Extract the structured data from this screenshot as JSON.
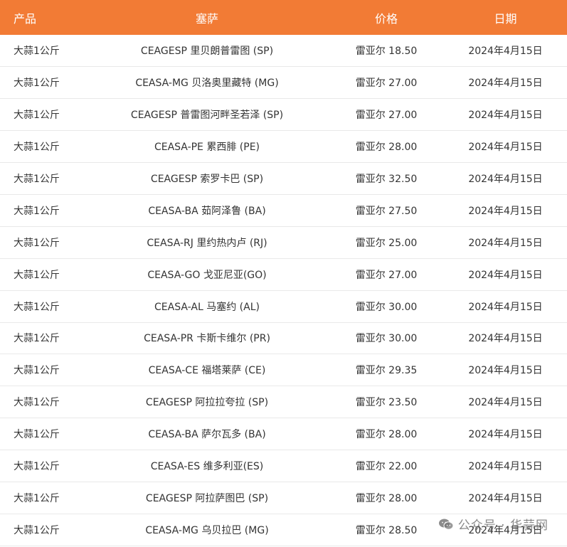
{
  "table": {
    "headers": {
      "product": "产品",
      "market": "塞萨",
      "price": "价格",
      "date": "日期"
    },
    "rows": [
      {
        "product": "大蒜1公斤",
        "market": "CEAGESP 里贝朗普雷图 (SP)",
        "price": "雷亚尔 18.50",
        "date": "2024年4月15日"
      },
      {
        "product": "大蒜1公斤",
        "market": "CEASA-MG 贝洛奥里藏特 (MG)",
        "price": "雷亚尔 27.00",
        "date": "2024年4月15日"
      },
      {
        "product": "大蒜1公斤",
        "market": "CEAGESP 普雷图河畔圣若泽 (SP)",
        "price": "雷亚尔 27.00",
        "date": "2024年4月15日"
      },
      {
        "product": "大蒜1公斤",
        "market": "CEASA-PE 累西腓 (PE)",
        "price": "雷亚尔 28.00",
        "date": "2024年4月15日"
      },
      {
        "product": "大蒜1公斤",
        "market": "CEAGESP 索罗卡巴 (SP)",
        "price": "雷亚尔 32.50",
        "date": "2024年4月15日"
      },
      {
        "product": "大蒜1公斤",
        "market": "CEASA-BA 茹阿泽鲁 (BA)",
        "price": "雷亚尔 27.50",
        "date": "2024年4月15日"
      },
      {
        "product": "大蒜1公斤",
        "market": "CEASA-RJ 里约热内卢 (RJ)",
        "price": "雷亚尔 25.00",
        "date": "2024年4月15日"
      },
      {
        "product": "大蒜1公斤",
        "market": "CEASA-GO 戈亚尼亚(GO)",
        "price": "雷亚尔 27.00",
        "date": "2024年4月15日"
      },
      {
        "product": "大蒜1公斤",
        "market": "CEASA-AL 马塞约 (AL)",
        "price": "雷亚尔 30.00",
        "date": "2024年4月15日"
      },
      {
        "product": "大蒜1公斤",
        "market": "CEASA-PR 卡斯卡维尔 (PR)",
        "price": "雷亚尔 30.00",
        "date": "2024年4月15日"
      },
      {
        "product": "大蒜1公斤",
        "market": "CEASA-CE 福塔莱萨 (CE)",
        "price": "雷亚尔 29.35",
        "date": "2024年4月15日"
      },
      {
        "product": "大蒜1公斤",
        "market": "CEAGESP 阿拉拉夸拉 (SP)",
        "price": "雷亚尔 23.50",
        "date": "2024年4月15日"
      },
      {
        "product": "大蒜1公斤",
        "market": "CEASA-BA 萨尔瓦多 (BA)",
        "price": "雷亚尔 28.00",
        "date": "2024年4月15日"
      },
      {
        "product": "大蒜1公斤",
        "market": "CEASA-ES 维多利亚(ES)",
        "price": "雷亚尔 22.00",
        "date": "2024年4月15日"
      },
      {
        "product": "大蒜1公斤",
        "market": "CEAGESP 阿拉萨图巴 (SP)",
        "price": "雷亚尔 28.00",
        "date": "2024年4月15日"
      },
      {
        "product": "大蒜1公斤",
        "market": "CEASA-MG 乌贝拉巴 (MG)",
        "price": "雷亚尔 28.50",
        "date": "2024年4月15日"
      }
    ]
  },
  "watermark": {
    "text": "公众号 · 华蒜网",
    "icon": "wechat-icon"
  },
  "colors": {
    "header_bg": "#f27b35",
    "header_text": "#ffffff",
    "row_divider": "#e9e9e9",
    "body_text": "#333333"
  }
}
